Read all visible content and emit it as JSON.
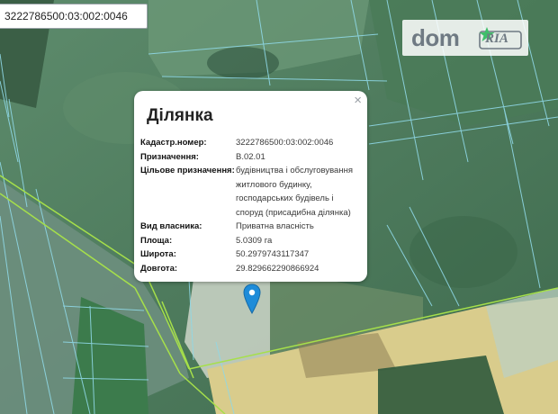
{
  "search": {
    "value": "3222786500:03:002:0046"
  },
  "logo": {
    "dom": "dom",
    "ria": "RIA"
  },
  "popup": {
    "close": "×",
    "title": "Ділянка",
    "rows": [
      {
        "label": "Кадастр.номер:",
        "value": "3222786500:03:002:0046"
      },
      {
        "label": "Призначення:",
        "value": "В.02.01"
      },
      {
        "label": "Цільове призначення:",
        "value": "будівництва і обслуговування житлового будинку, господарських будівель і споруд (присадибна ділянка)"
      },
      {
        "label": "Вид власника:",
        "value": "Приватна власність"
      },
      {
        "label": "Площа:",
        "value": "5.0309 га"
      },
      {
        "label": "Широта:",
        "value": "50.2979743117347"
      },
      {
        "label": "Довгота:",
        "value": "29.829662290866924"
      }
    ]
  },
  "colors": {
    "parcel_lines": "#8fd8e6",
    "boundary_lines": "#a6e04a",
    "marker": "#1e8cd9"
  },
  "icons": {
    "marker": "map-pin-icon",
    "close": "close-icon"
  }
}
